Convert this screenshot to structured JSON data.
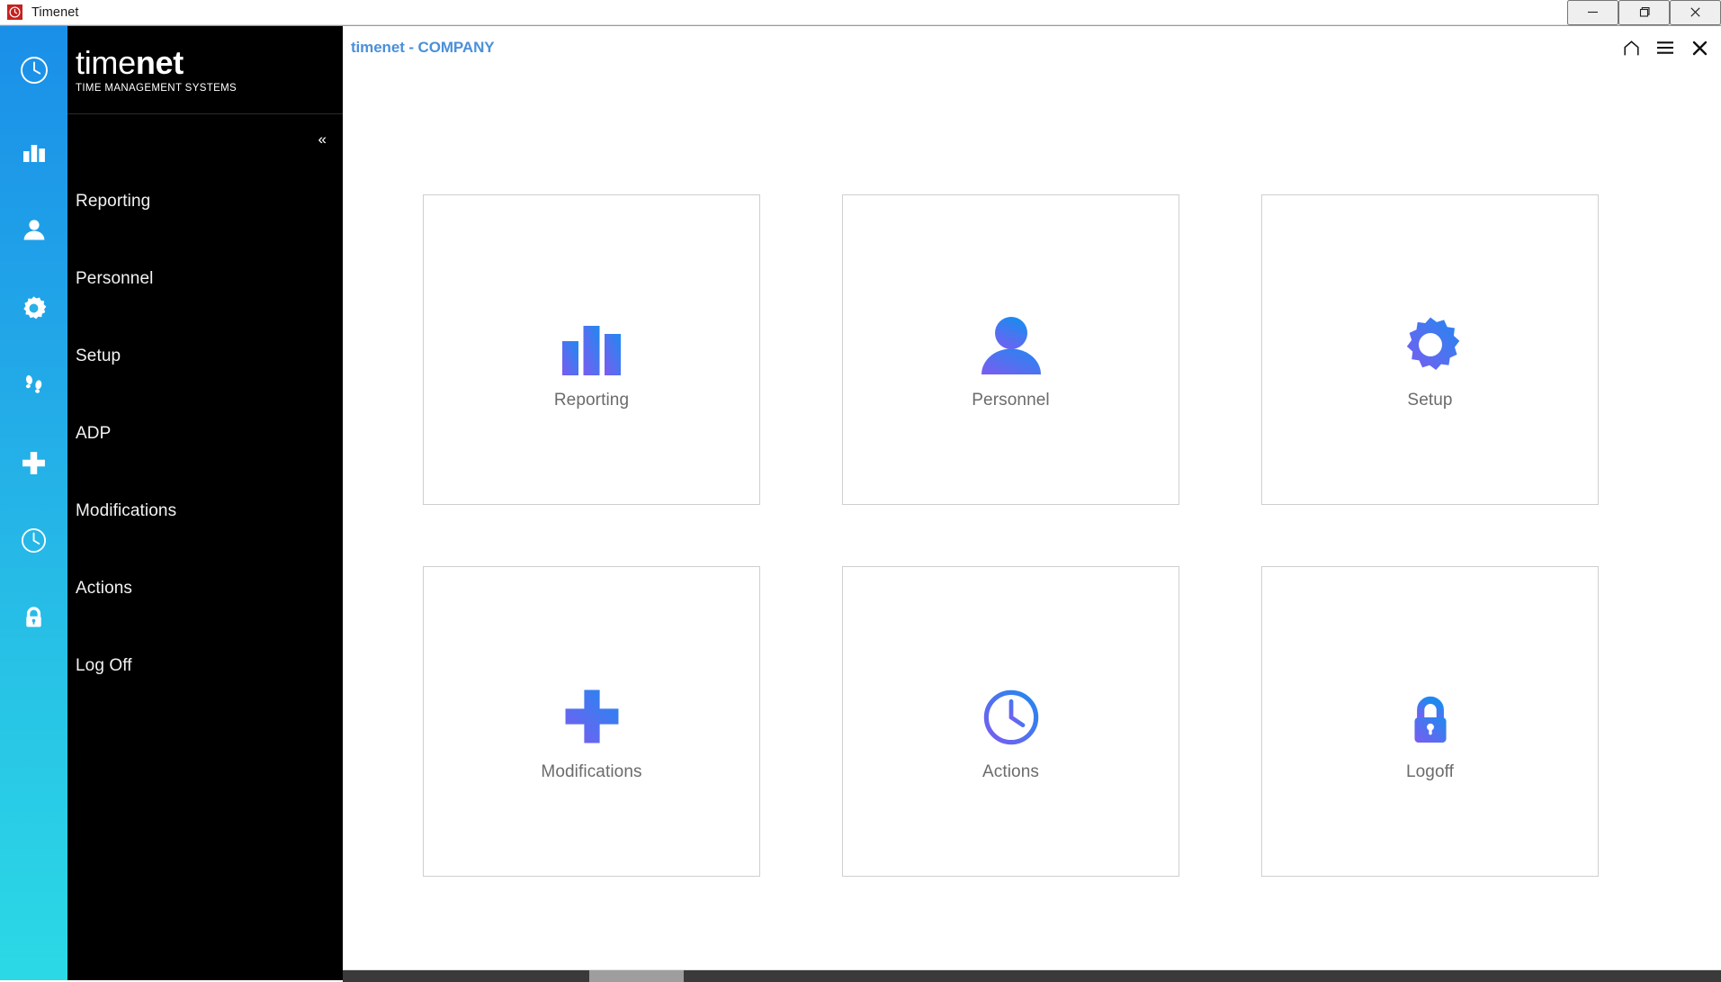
{
  "window": {
    "app_icon": "clock-icon",
    "title": "Timenet",
    "minimize_label": "Minimize",
    "maximize_label": "Maximize",
    "close_label": "Close"
  },
  "brand": {
    "name_light": "time",
    "name_bold": "net",
    "tagline": "TIME MANAGEMENT SYSTEMS",
    "logo_icon": "clock-icon"
  },
  "sidebar": {
    "collapse_label": "«",
    "items": [
      {
        "label": "Reporting",
        "icon": "bar-chart-icon"
      },
      {
        "label": "Personnel",
        "icon": "person-icon"
      },
      {
        "label": "Setup",
        "icon": "gear-icon"
      },
      {
        "label": "ADP",
        "icon": "footprints-icon"
      },
      {
        "label": "Modifications",
        "icon": "plus-icon"
      },
      {
        "label": "Actions",
        "icon": "clock-icon"
      },
      {
        "label": "Log Off",
        "icon": "lock-icon"
      }
    ]
  },
  "header": {
    "title": "timenet - COMPANY",
    "actions": [
      {
        "name": "home-icon",
        "label": "Home"
      },
      {
        "name": "menu-icon",
        "label": "Menu"
      },
      {
        "name": "close-icon",
        "label": "Close"
      }
    ]
  },
  "tiles": [
    {
      "label": "Reporting",
      "icon": "bar-chart-icon"
    },
    {
      "label": "Personnel",
      "icon": "person-icon"
    },
    {
      "label": "Setup",
      "icon": "gear-icon"
    },
    {
      "label": "Modifications",
      "icon": "plus-icon"
    },
    {
      "label": "Actions",
      "icon": "clock-icon"
    },
    {
      "label": "Logoff",
      "icon": "lock-icon"
    }
  ],
  "colors": {
    "rail_top": "#1a8fe8",
    "rail_bottom": "#2bd9e5",
    "nav_background": "#000000",
    "title_accent": "#4a90d9",
    "tile_border": "#cfcfcf",
    "tile_label": "#6b6b6b",
    "gradient_start": "#7b5cf0",
    "gradient_end": "#2089f0",
    "app_icon_background": "#c5221f"
  }
}
